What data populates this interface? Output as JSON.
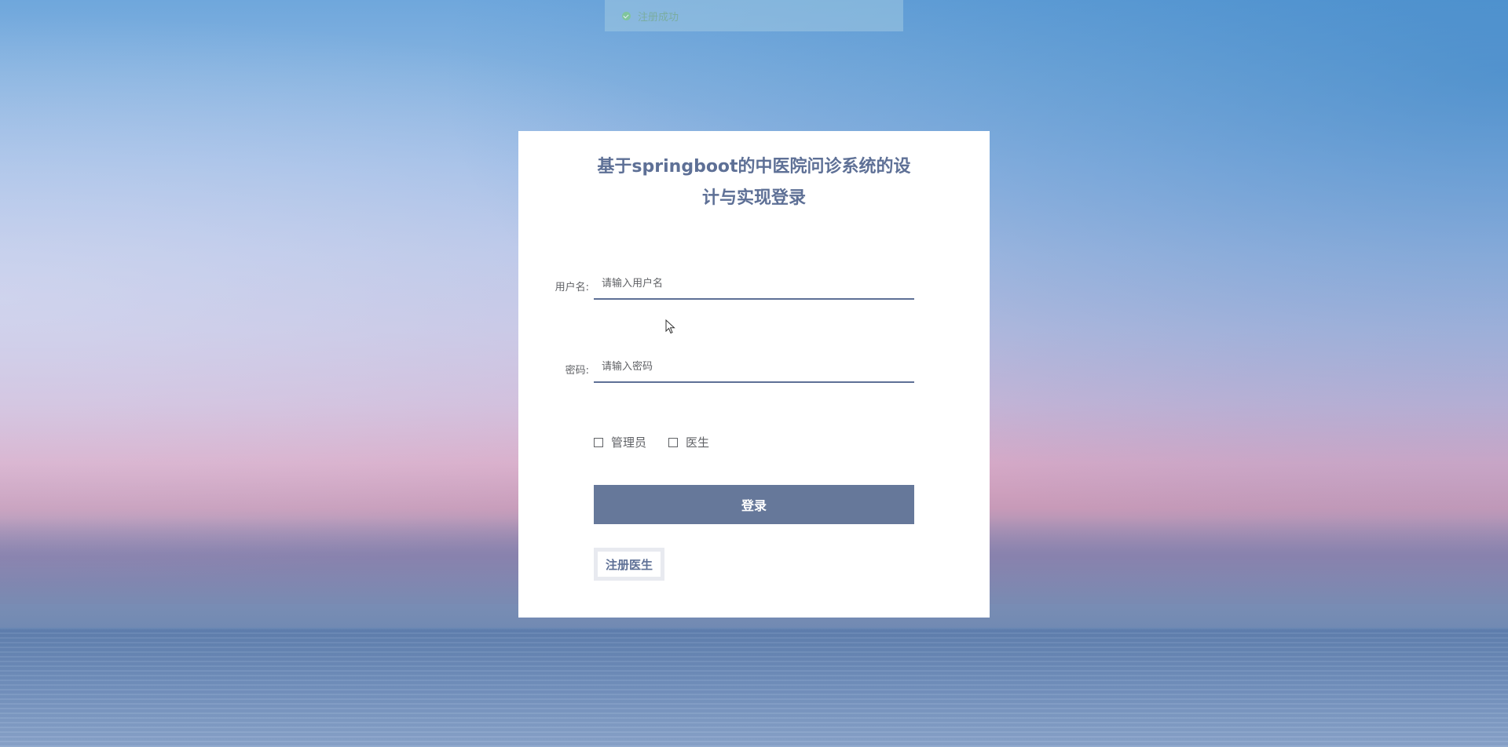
{
  "toast": {
    "icon": "check-circle-icon",
    "message": "注册成功"
  },
  "login": {
    "title": "基于springboot的中医院问诊系统的设计与实现登录",
    "username": {
      "label": "用户名:",
      "placeholder": "请输入用户名",
      "value": ""
    },
    "password": {
      "label": "密码:",
      "placeholder": "请输入密码",
      "value": ""
    },
    "roles": [
      {
        "label": "管理员",
        "checked": false
      },
      {
        "label": "医生",
        "checked": false
      }
    ],
    "login_button": "登录",
    "register_button": "注册医生"
  },
  "colors": {
    "accent": "#5e7096",
    "button_bg": "#66789a",
    "toast_icon": "#7fc98e"
  }
}
